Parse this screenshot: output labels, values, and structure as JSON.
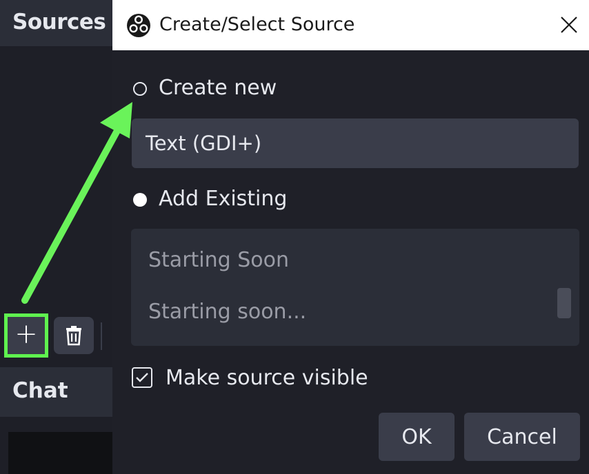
{
  "background_app": {
    "sources_panel": {
      "title": "Sources"
    },
    "toolbar": {
      "add_icon": "plus-icon",
      "remove_icon": "trash-icon"
    },
    "chat_panel": {
      "title": "Chat"
    }
  },
  "dialog": {
    "title": "Create/Select Source",
    "app_icon": "obs-logo-icon",
    "close_icon": "close-icon",
    "create_new": {
      "label": "Create new",
      "selected": false
    },
    "name_field": {
      "value": "Text (GDI+)"
    },
    "add_existing": {
      "label": "Add Existing",
      "selected": true
    },
    "existing_sources": [
      "Starting Soon",
      "Starting soon..."
    ],
    "make_visible": {
      "label": "Make source visible",
      "checked": true
    },
    "ok_label": "OK",
    "cancel_label": "Cancel"
  },
  "annotation": {
    "highlight_color": "#5ff34f",
    "arrow_color": "#6af35a"
  },
  "colors": {
    "panel_bg": "#1e1f27",
    "panel_header": "#2b2e38",
    "control_bg": "#3a3d4a",
    "text": "#e6e8ee",
    "muted_text": "#9a9ca6"
  }
}
